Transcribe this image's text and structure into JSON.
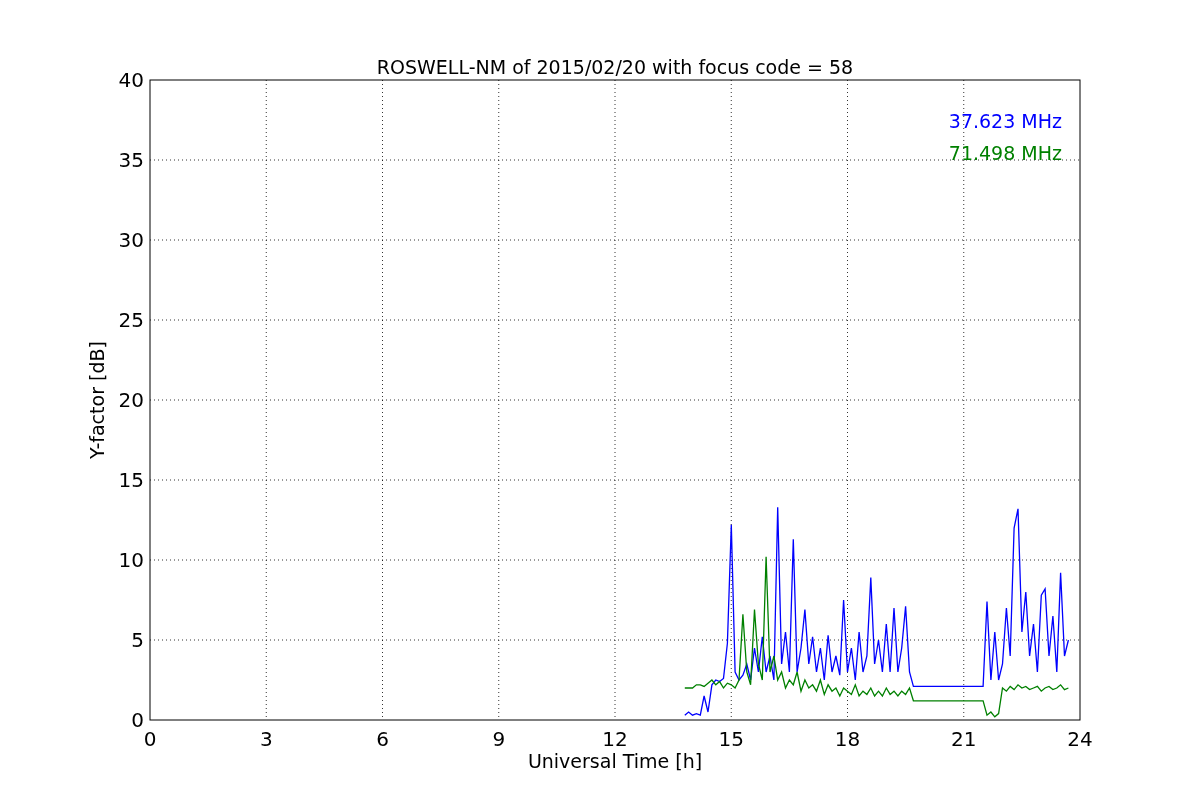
{
  "chart_data": {
    "type": "line",
    "title": "ROSWELL-NM of 2015/02/20 with focus code = 58",
    "xlabel": "Universal Time [h]",
    "ylabel": "Y-factor [dB]",
    "x": [
      13.8,
      13.9,
      14.0,
      14.1,
      14.2,
      14.3,
      14.4,
      14.5,
      14.6,
      14.7,
      14.8,
      14.9,
      15.0,
      15.1,
      15.2,
      15.3,
      15.4,
      15.5,
      15.6,
      15.7,
      15.8,
      15.9,
      16.0,
      16.1,
      16.2,
      16.3,
      16.4,
      16.5,
      16.6,
      16.7,
      16.8,
      16.9,
      17.0,
      17.1,
      17.2,
      17.3,
      17.4,
      17.5,
      17.6,
      17.7,
      17.8,
      17.9,
      18.0,
      18.1,
      18.2,
      18.3,
      18.4,
      18.5,
      18.6,
      18.7,
      18.8,
      18.9,
      19.0,
      19.1,
      19.2,
      19.3,
      19.4,
      19.5,
      19.6,
      19.7,
      21.5,
      21.6,
      21.7,
      21.8,
      21.9,
      22.0,
      22.1,
      22.2,
      22.3,
      22.4,
      22.5,
      22.6,
      22.7,
      22.8,
      22.9,
      23.0,
      23.1,
      23.2,
      23.3,
      23.4,
      23.5,
      23.6,
      23.7
    ],
    "series": [
      {
        "name": "37.623 MHz",
        "color": "#0000ff",
        "values": [
          0.3,
          0.5,
          0.3,
          0.4,
          0.3,
          1.5,
          0.5,
          2.2,
          2.5,
          2.4,
          2.6,
          4.8,
          12.2,
          3.0,
          2.5,
          2.8,
          3.5,
          2.5,
          4.5,
          3.0,
          5.2,
          3.0,
          4.0,
          2.5,
          13.3,
          3.5,
          5.5,
          3.0,
          11.3,
          3.0,
          4.5,
          6.9,
          3.5,
          5.2,
          3.0,
          4.5,
          2.5,
          5.3,
          3.0,
          4.0,
          2.8,
          7.5,
          3.0,
          4.5,
          2.5,
          5.5,
          3.0,
          4.0,
          8.9,
          3.5,
          5.0,
          3.0,
          6.0,
          3.0,
          7.0,
          3.0,
          4.5,
          7.1,
          3.0,
          2.1,
          2.1,
          7.4,
          2.5,
          5.5,
          2.5,
          3.5,
          7.0,
          4.0,
          12.0,
          13.2,
          5.5,
          8.0,
          4.0,
          6.0,
          3.0,
          7.8,
          8.2,
          4.0,
          6.5,
          3.0,
          9.2,
          4.0,
          5.0
        ]
      },
      {
        "name": "71.498 MHz",
        "color": "#008000",
        "values": [
          2.0,
          2.0,
          2.0,
          2.2,
          2.2,
          2.1,
          2.3,
          2.5,
          2.2,
          2.4,
          2.0,
          2.3,
          2.2,
          2.0,
          2.5,
          6.6,
          3.0,
          2.2,
          6.9,
          3.5,
          2.5,
          10.2,
          3.0,
          4.0,
          2.5,
          3.0,
          2.0,
          2.5,
          2.2,
          3.0,
          1.8,
          2.5,
          2.0,
          2.2,
          1.8,
          2.5,
          1.6,
          2.2,
          1.8,
          2.0,
          1.5,
          2.0,
          1.8,
          1.6,
          2.2,
          1.5,
          1.8,
          1.6,
          2.0,
          1.5,
          1.8,
          1.5,
          2.0,
          1.6,
          1.8,
          1.5,
          1.8,
          1.6,
          2.0,
          1.2,
          1.2,
          0.3,
          0.5,
          0.2,
          0.4,
          2.0,
          1.8,
          2.1,
          1.9,
          2.2,
          2.0,
          2.1,
          1.9,
          2.0,
          2.1,
          1.8,
          2.0,
          2.1,
          1.9,
          2.0,
          2.2,
          1.9,
          2.0
        ]
      }
    ],
    "grid": true,
    "xlim": [
      0,
      24
    ],
    "ylim": [
      0,
      40
    ],
    "xticks": [
      0,
      3,
      6,
      9,
      12,
      15,
      18,
      21,
      24
    ],
    "yticks": [
      0,
      5,
      10,
      15,
      20,
      25,
      30,
      35,
      40
    ]
  }
}
